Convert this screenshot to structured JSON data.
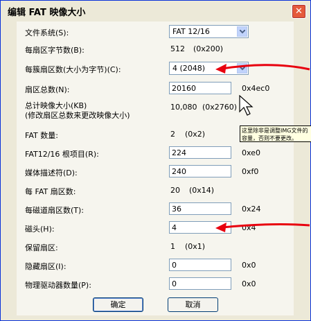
{
  "window": {
    "title": "编辑 FAT 映像大小",
    "close_label": "✕"
  },
  "fields": [
    {
      "label": "文件系统(S):",
      "type": "select",
      "value": "FAT 12/16"
    },
    {
      "label": "每扇区字节数(B):",
      "type": "text",
      "value": "512",
      "hex": "(0x200)"
    },
    {
      "label": "每簇扇区数(大小为字节)(C):",
      "type": "select",
      "value": "4  (2048)"
    },
    {
      "label": "扇区总数(N):",
      "type": "input",
      "value": "20160",
      "hex": "0x4ec0"
    },
    {
      "label": "总计映像大小(KB)",
      "label2": "(修改扇区总数来更改映像大小)",
      "type": "text",
      "value": "10,080",
      "hex": "(0x2760)"
    },
    {
      "label": "FAT 数量:",
      "type": "text",
      "value": "2",
      "hex": "(0x2)"
    },
    {
      "label": "FAT12/16 根项目(R):",
      "type": "input",
      "value": "224",
      "hex": "0xe0"
    },
    {
      "label": "媒体描述符(D):",
      "type": "input",
      "value": "240",
      "hex": "0xf0"
    },
    {
      "label": "每 FAT 扇区数:",
      "type": "text",
      "value": "20",
      "hex": "(0x14)"
    },
    {
      "label": "每磁道扇区数(T):",
      "type": "input",
      "value": "36",
      "hex": "0x24"
    },
    {
      "label": "磁头(H):",
      "type": "input",
      "value": "4",
      "hex": "0x4"
    },
    {
      "label": "保留扇区:",
      "type": "text",
      "value": "1",
      "hex": "(0x1)"
    },
    {
      "label": "隐藏扇区(I):",
      "type": "input",
      "value": "0",
      "hex": "0x0"
    },
    {
      "label": "物理驱动器数量(P):",
      "type": "input",
      "value": "0",
      "hex": "0x0"
    }
  ],
  "buttons": {
    "ok": "确定",
    "cancel": "取消"
  },
  "tooltip": {
    "text": "这里除非是调整IMG文件的容量，否则不要更改。"
  },
  "colors": {
    "accent_arrow": "#e8000e",
    "title_border": "#0831d9",
    "close_bg": "#e5593b"
  }
}
